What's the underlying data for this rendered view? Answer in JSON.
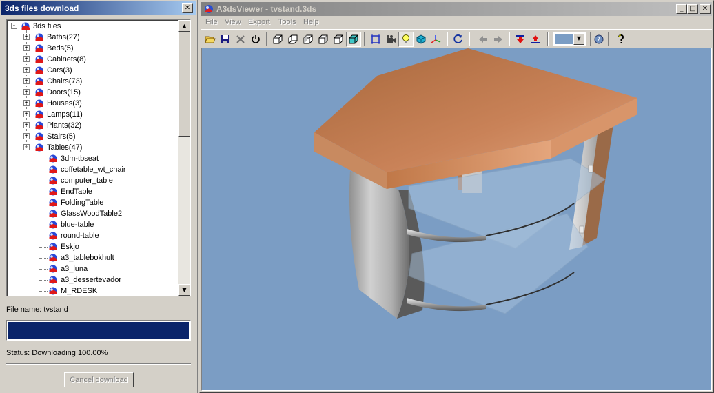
{
  "download_panel": {
    "title": "3ds files download",
    "close_glyph": "✕",
    "tree": {
      "root": "3ds files",
      "categories": [
        {
          "label": "Baths(27)"
        },
        {
          "label": "Beds(5)"
        },
        {
          "label": "Cabinets(8)"
        },
        {
          "label": "Cars(3)"
        },
        {
          "label": "Chairs(73)"
        },
        {
          "label": "Doors(15)"
        },
        {
          "label": "Houses(3)"
        },
        {
          "label": "Lamps(11)"
        },
        {
          "label": "Plants(32)"
        },
        {
          "label": "Stairs(5)"
        },
        {
          "label": "Tables(47)"
        }
      ],
      "table_items": [
        "3dm-tbseat",
        "coffetable_wt_chair",
        "computer_table",
        "EndTable",
        "FoldingTable",
        "GlassWoodTable2",
        "blue-table",
        "round-table",
        "Eskjo",
        "a3_tablebokhult",
        "a3_luna",
        "a3_dessertevador",
        "M_RDESK"
      ]
    },
    "file_name_text": "File name: tvstand",
    "progress_fraction": 1.0,
    "status_text": "Status: Downloading  100.00%",
    "cancel_label": "Cancel download"
  },
  "viewer": {
    "title": "A3dsViewer - tvstand.3ds",
    "min_glyph": "_",
    "max_glyph": "□",
    "close_glyph": "✕",
    "menu": [
      "File",
      "View",
      "Export",
      "Tools",
      "Help"
    ],
    "background_color": "#7b9dc4",
    "toolbar_icons": [
      "open-folder-icon",
      "save-disk-icon",
      "close-x-icon",
      "power-icon",
      "cube-front-icon",
      "cube-back-icon",
      "cube-left-icon",
      "cube-right-icon",
      "cube-top-icon",
      "cube-shaded-icon",
      "fit-frame-icon",
      "camera-icon",
      "light-bulb-icon",
      "box-icon",
      "axes-icon",
      "rotate-icon",
      "arrow-left-icon",
      "arrow-right-icon",
      "download-red-icon",
      "upload-red-icon",
      "globe-info-icon",
      "help-question-icon"
    ]
  }
}
